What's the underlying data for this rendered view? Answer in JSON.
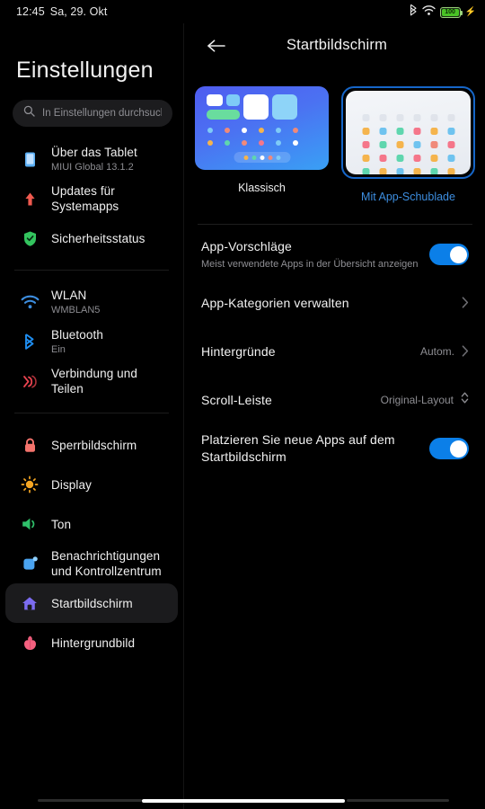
{
  "statusbar": {
    "time": "12:45",
    "date": "Sa, 29. Okt",
    "icons": [
      "bluetooth-icon",
      "wifi-icon",
      "battery-icon",
      "charging-bolt-icon"
    ],
    "battery_level": "100"
  },
  "sidebar": {
    "title": "Einstellungen",
    "search": {
      "placeholder": "In Einstellungen durchsuchen",
      "value": "",
      "icon": "search-icon"
    },
    "groups": [
      {
        "items": [
          {
            "label": "Über das Tablet",
            "sublabel": "MIUI Global 13.1.2",
            "icon": "tablet-icon",
            "color": "#5aaff5",
            "selected": false
          },
          {
            "label": "Updates für Systemapps",
            "sublabel": "",
            "icon": "up-arrow-icon",
            "color": "#f05a4f",
            "selected": false
          },
          {
            "label": "Sicherheitsstatus",
            "sublabel": "",
            "icon": "shield-check-icon",
            "color": "#33c45e",
            "selected": false
          }
        ]
      },
      {
        "items": [
          {
            "label": "WLAN",
            "sublabel": "WMBLAN5",
            "icon": "wifi-icon",
            "color": "#3d8ee0",
            "selected": false
          },
          {
            "label": "Bluetooth",
            "sublabel": "Ein",
            "icon": "bluetooth-icon",
            "color": "#1f8ef1",
            "selected": false
          },
          {
            "label": "Verbindung und Teilen",
            "sublabel": "",
            "icon": "share-connection-icon",
            "color": "#e8434f",
            "selected": false
          }
        ]
      },
      {
        "items": [
          {
            "label": "Sperrbildschirm",
            "sublabel": "",
            "icon": "lock-icon",
            "color": "#f4736c",
            "selected": false
          },
          {
            "label": "Display",
            "sublabel": "",
            "icon": "brightness-sun-icon",
            "color": "#f5a623",
            "selected": false
          },
          {
            "label": "Ton",
            "sublabel": "",
            "icon": "speaker-icon",
            "color": "#2fc06a",
            "selected": false
          },
          {
            "label": "Benachrichtigungen und Kontrollzentrum",
            "sublabel": "",
            "icon": "notification-icon",
            "color": "#4aa3f0",
            "selected": false
          },
          {
            "label": "Startbildschirm",
            "sublabel": "",
            "icon": "home-icon",
            "color": "#7c6cf0",
            "selected": true
          },
          {
            "label": "Hintergrundbild",
            "sublabel": "",
            "icon": "flower-wallpaper-icon",
            "color": "#f4607f",
            "selected": false
          }
        ]
      }
    ]
  },
  "main": {
    "back_icon": "back-arrow-icon",
    "title": "Startbildschirm",
    "layout_options": [
      {
        "label": "Klassisch",
        "selected": false,
        "preview": "classic-home-preview"
      },
      {
        "label": "Mit App-Schublade",
        "selected": true,
        "preview": "app-drawer-preview"
      }
    ],
    "settings": [
      {
        "name": "app-suggestions",
        "title": "App-Vorschläge",
        "sublabel": "Meist verwendete Apps in der Übersicht anzeigen",
        "control": "toggle",
        "value": "on"
      },
      {
        "name": "manage-app-categories",
        "title": "App-Kategorien verwalten",
        "sublabel": "",
        "control": "chevron",
        "value": ""
      },
      {
        "name": "backgrounds",
        "title": "Hintergründe",
        "sublabel": "",
        "control": "value-chevron",
        "value": "Autom."
      },
      {
        "name": "scroll-bar",
        "title": "Scroll-Leiste",
        "sublabel": "",
        "control": "value-stepper",
        "value": "Original-Layout"
      },
      {
        "name": "place-new-apps-on-home",
        "title": "Platzieren Sie neue Apps auf dem Startbildschirm",
        "sublabel": "",
        "control": "toggle",
        "value": "on"
      }
    ]
  },
  "colors": {
    "accent_blue": "#0b7fe8",
    "selected_label": "#3d8ee0",
    "selection_border": "#1666c8",
    "background": "#000000",
    "row_selected_bg": "#1b1b1d"
  },
  "gesture_bar": {
    "icon": "home-gesture-pill"
  }
}
